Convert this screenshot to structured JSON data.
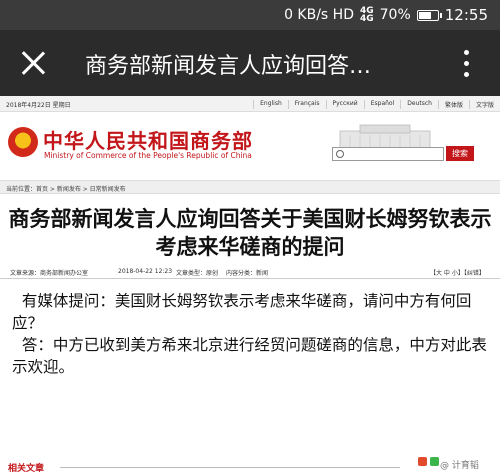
{
  "status_bar": {
    "speed": "0 KB/s HD",
    "signal_1": "4G",
    "signal_2": "4G",
    "battery": "70%",
    "battery_level": 0.7,
    "time": "12:55"
  },
  "app_bar": {
    "title": "商务部新闻发言人应询回答…"
  },
  "site_top": {
    "date": "2018年4月22日   星期日",
    "languages": [
      "English",
      "Français",
      "Русский",
      "Español",
      "Deutsch",
      "繁体版",
      "文字版"
    ]
  },
  "header": {
    "cn_name": "中华人民共和国商务部",
    "en_name": "Ministry of Commerce of the People's Republic of China",
    "search_button": "搜索"
  },
  "breadcrumb": "当前位置：首页 > 新闻发布 > 日常新闻发布",
  "article": {
    "title": "商务部新闻发言人应询回答关于美国财长姆努钦表示考虑来华磋商的提问",
    "source": "文章来源：商务部新闻办公室",
    "date": "2018-04-22 12:23",
    "type": "文章类型：原创",
    "category": "内容分类：新闻",
    "font_size_ctrl": "【大 中 小】【纠错】",
    "question": "有媒体提问：美国财长姆努钦表示考虑来华磋商，请问中方有何回应？",
    "answer": "答：中方已收到美方希来北京进行经贸问题磋商的信息，中方对此表示欢迎。"
  },
  "footer": {
    "related": "相关文章",
    "watermark": "@ 计育韬"
  }
}
